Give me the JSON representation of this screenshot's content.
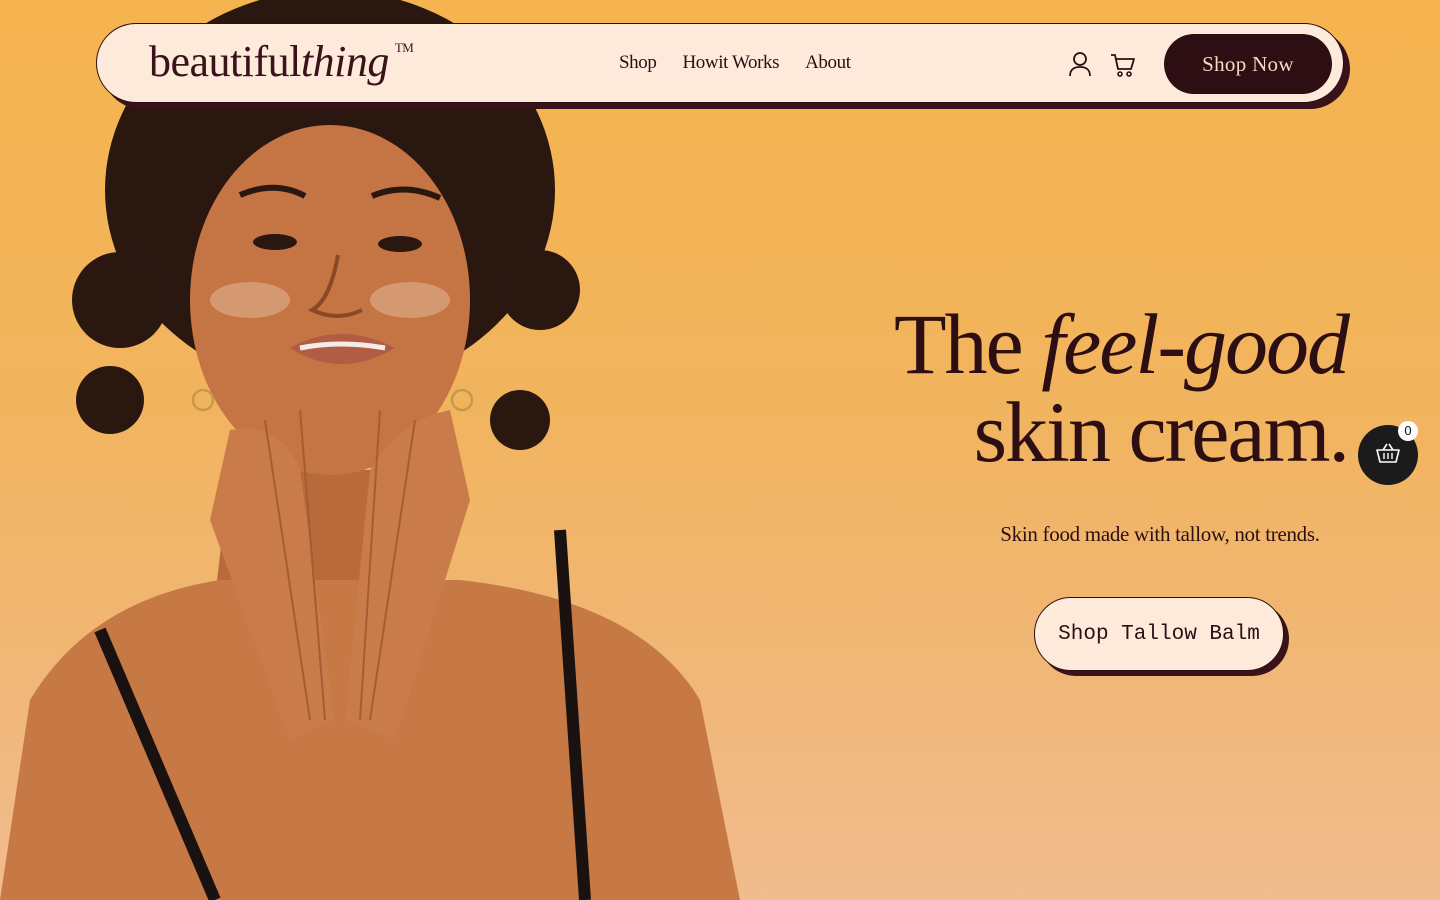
{
  "brand": {
    "logo_main": "beautiful",
    "logo_italic": "thing",
    "logo_tm": "TM"
  },
  "nav": {
    "links": [
      {
        "label": "Shop"
      },
      {
        "label": "Howit Works"
      },
      {
        "label": "About"
      }
    ],
    "account_icon": "user-icon",
    "cart_icon": "cart-icon",
    "shop_now_label": "Shop Now"
  },
  "hero": {
    "headline_the": "The",
    "headline_italic": "feel-good",
    "headline_line2": "skin cream.",
    "subheadline": "Skin food made with tallow, not trends.",
    "cta_label": "Shop Tallow Balm"
  },
  "floating_cart": {
    "icon": "basket-icon",
    "count": "0"
  },
  "colors": {
    "background": "#f6b44f",
    "dark_brown": "#2d0e13",
    "cream": "#fdeadb"
  }
}
